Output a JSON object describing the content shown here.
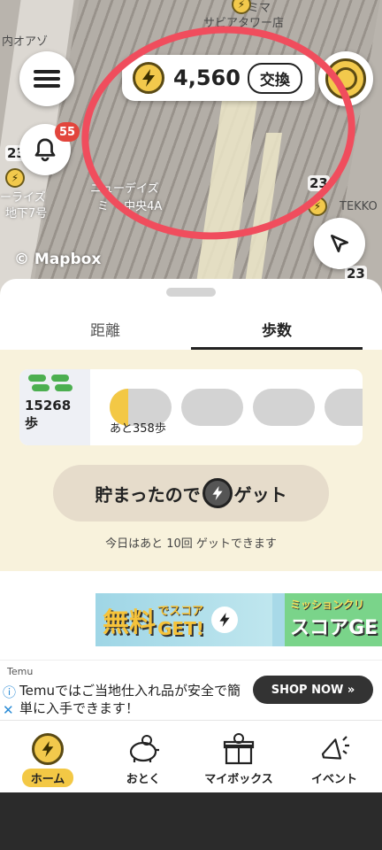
{
  "map": {
    "labels": [
      "サビアタワー店",
      "内オアゾ",
      "ミマ",
      "ーライズ",
      "地下7号",
      "ニューデイズ",
      "ミ ・中央4A",
      "TEKKO"
    ],
    "pin_numbers": [
      "23",
      "23",
      "23"
    ],
    "attribution": "© Mapbox"
  },
  "header": {
    "notification_count": "55",
    "points": "4,560",
    "exchange_label": "交換"
  },
  "sheet": {
    "tabs": [
      {
        "label": "距離",
        "active": false
      },
      {
        "label": "歩数",
        "active": true
      }
    ],
    "steps": {
      "count": "15268",
      "unit": "歩",
      "remaining_label": "あと358歩",
      "first_segment_fill": 0.3
    },
    "collect_button": {
      "label_before": "貯まったので",
      "label_after": "ゲット"
    },
    "remaining_today": "今日はあと 10回 ゲットできます"
  },
  "banner": {
    "free": "無料",
    "small": "でスコア",
    "get": "GET!",
    "mission_title": "ミッションクリ",
    "mission_sub": "スコアGE"
  },
  "ad": {
    "brand": "Temu",
    "text": "Temuではご当地仕入れ品が安全で簡単に入手できます！",
    "button": "SHOP NOW »"
  },
  "bottom_nav": {
    "items": [
      {
        "label": "ホーム",
        "icon": "bolt-coin-icon",
        "active": true
      },
      {
        "label": "おとく",
        "icon": "piggy-bank-icon",
        "active": false
      },
      {
        "label": "マイボックス",
        "icon": "gift-box-icon",
        "active": false
      },
      {
        "label": "イベント",
        "icon": "megaphone-icon",
        "active": false
      }
    ]
  },
  "colors": {
    "accent_yellow": "#f3c845",
    "annotation_red": "#f04d5d",
    "badge_red": "#e2453c",
    "cream": "#f8f2dc"
  }
}
